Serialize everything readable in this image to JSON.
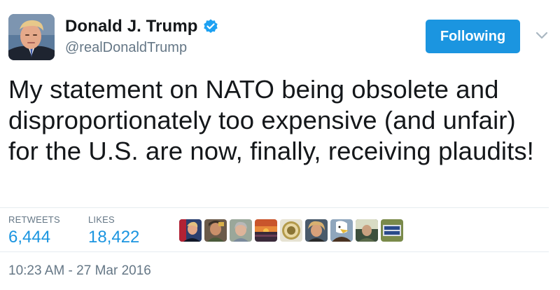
{
  "author": {
    "name": "Donald J. Trump",
    "handle": "@realDonaldTrump",
    "verified": true,
    "avatar_icon": "profile-photo"
  },
  "follow_button": {
    "label": "Following",
    "color": "#1b95e0"
  },
  "menu_icon": "chevron-down-icon",
  "tweet": {
    "text": "My statement on NATO being obsolete and disproportionately too expensive (and unfair) for the U.S. are now, finally, receiving plaudits!"
  },
  "stats": {
    "retweets_label": "RETWEETS",
    "retweets_count": "6,444",
    "likes_label": "LIKES",
    "likes_count": "18,422"
  },
  "liker_avatars": [
    {
      "name": "liker-1"
    },
    {
      "name": "liker-2"
    },
    {
      "name": "liker-3"
    },
    {
      "name": "liker-4"
    },
    {
      "name": "liker-5"
    },
    {
      "name": "liker-6"
    },
    {
      "name": "liker-7"
    },
    {
      "name": "liker-8"
    },
    {
      "name": "liker-9"
    }
  ],
  "timestamp": "10:23 AM - 27 Mar 2016",
  "colors": {
    "accent": "#1b95e0",
    "text": "#14171a",
    "muted": "#657786",
    "divider": "#e6ecf0"
  }
}
